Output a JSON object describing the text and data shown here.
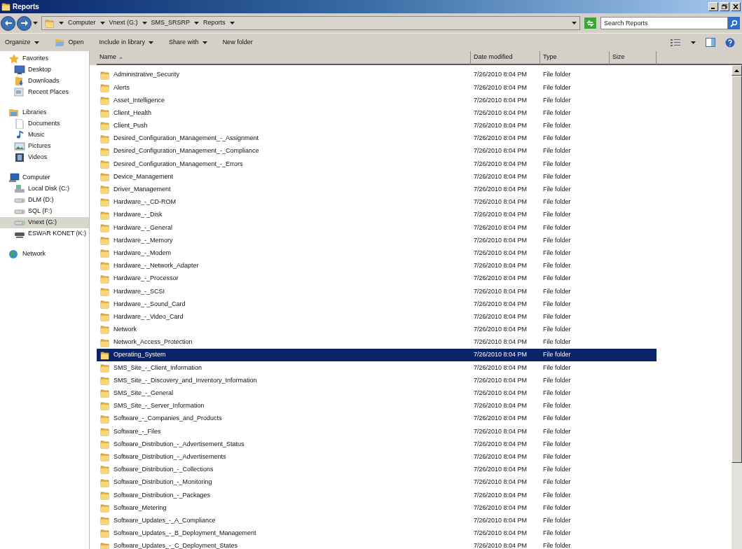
{
  "window": {
    "title": "Reports"
  },
  "address": {
    "crumbs": [
      "Computer",
      "Vnext (G:)",
      "SMS_SRSRP",
      "Reports"
    ]
  },
  "search": {
    "placeholder": "Search Reports"
  },
  "toolbar": [
    {
      "label": "Organize",
      "kind": "menu"
    },
    {
      "label": "Open",
      "kind": "open"
    },
    {
      "label": "Include in library",
      "kind": "menu"
    },
    {
      "label": "Share with",
      "kind": "menu"
    },
    {
      "label": "New folder",
      "kind": "plain"
    }
  ],
  "sidebar": {
    "groups": [
      {
        "label": "Favorites",
        "kind": "star",
        "selected": false,
        "children": [
          {
            "label": "Desktop",
            "kind": "desktop",
            "selected": false
          },
          {
            "label": "Downloads",
            "kind": "downloads",
            "selected": false
          },
          {
            "label": "Recent Places",
            "kind": "recent",
            "selected": false
          }
        ]
      },
      {
        "label": "Libraries",
        "kind": "library",
        "selected": false,
        "children": [
          {
            "label": "Documents",
            "kind": "document",
            "selected": false
          },
          {
            "label": "Music",
            "kind": "music",
            "selected": false
          },
          {
            "label": "Pictures",
            "kind": "pictures",
            "selected": false
          },
          {
            "label": "Videos",
            "kind": "videos",
            "selected": false
          }
        ]
      },
      {
        "label": "Computer",
        "kind": "computer",
        "selected": false,
        "children": [
          {
            "label": "Local Disk (C:)",
            "kind": "system",
            "selected": false
          },
          {
            "label": "DLM (D:)",
            "kind": "disk",
            "selected": false
          },
          {
            "label": "SQL (F:)",
            "kind": "disk",
            "selected": false
          },
          {
            "label": "Vnext (G:)",
            "kind": "disk",
            "selected": true
          },
          {
            "label": "ESWAR KONET (K:)",
            "kind": "netdrive",
            "selected": false
          }
        ]
      },
      {
        "label": "Network",
        "kind": "network",
        "selected": false
      }
    ]
  },
  "table": {
    "columns": [
      {
        "label": "Name",
        "sorted": true
      },
      {
        "label": "Date modified",
        "sorted": false
      },
      {
        "label": "Type",
        "sorted": false
      },
      {
        "label": "Size",
        "sorted": false
      }
    ],
    "rows": [
      {
        "name": "Administrative_Security",
        "date": "7/26/2010 8:04 PM",
        "type": "File folder",
        "selected": false
      },
      {
        "name": "Alerts",
        "date": "7/26/2010 8:04 PM",
        "type": "File folder",
        "selected": false
      },
      {
        "name": "Asset_Intelligence",
        "date": "7/26/2010 8:04 PM",
        "type": "File folder",
        "selected": false
      },
      {
        "name": "Client_Health",
        "date": "7/26/2010 8:04 PM",
        "type": "File folder",
        "selected": false
      },
      {
        "name": "Client_Push",
        "date": "7/26/2010 8:04 PM",
        "type": "File folder",
        "selected": false
      },
      {
        "name": "Desired_Configuration_Management_-_Assignment",
        "date": "7/26/2010 8:04 PM",
        "type": "File folder",
        "selected": false
      },
      {
        "name": "Desired_Configuration_Management_-_Compliance",
        "date": "7/26/2010 8:04 PM",
        "type": "File folder",
        "selected": false
      },
      {
        "name": "Desired_Configuration_Management_-_Errors",
        "date": "7/26/2010 8:04 PM",
        "type": "File folder",
        "selected": false
      },
      {
        "name": "Device_Management",
        "date": "7/26/2010 8:04 PM",
        "type": "File folder",
        "selected": false
      },
      {
        "name": "Driver_Management",
        "date": "7/26/2010 8:04 PM",
        "type": "File folder",
        "selected": false
      },
      {
        "name": "Hardware_-_CD-ROM",
        "date": "7/26/2010 8:04 PM",
        "type": "File folder",
        "selected": false
      },
      {
        "name": "Hardware_-_Disk",
        "date": "7/26/2010 8:04 PM",
        "type": "File folder",
        "selected": false
      },
      {
        "name": "Hardware_-_General",
        "date": "7/26/2010 8:04 PM",
        "type": "File folder",
        "selected": false
      },
      {
        "name": "Hardware_-_Memory",
        "date": "7/26/2010 8:04 PM",
        "type": "File folder",
        "selected": false
      },
      {
        "name": "Hardware_-_Modem",
        "date": "7/26/2010 8:04 PM",
        "type": "File folder",
        "selected": false
      },
      {
        "name": "Hardware_-_Network_Adapter",
        "date": "7/26/2010 8:04 PM",
        "type": "File folder",
        "selected": false
      },
      {
        "name": "Hardware_-_Processor",
        "date": "7/26/2010 8:04 PM",
        "type": "File folder",
        "selected": false
      },
      {
        "name": "Hardware_-_SCSI",
        "date": "7/26/2010 8:04 PM",
        "type": "File folder",
        "selected": false
      },
      {
        "name": "Hardware_-_Sound_Card",
        "date": "7/26/2010 8:04 PM",
        "type": "File folder",
        "selected": false
      },
      {
        "name": "Hardware_-_Video_Card",
        "date": "7/26/2010 8:04 PM",
        "type": "File folder",
        "selected": false
      },
      {
        "name": "Network",
        "date": "7/26/2010 8:04 PM",
        "type": "File folder",
        "selected": false
      },
      {
        "name": "Network_Access_Protection",
        "date": "7/26/2010 8:04 PM",
        "type": "File folder",
        "selected": false
      },
      {
        "name": "Operating_System",
        "date": "7/26/2010 8:04 PM",
        "type": "File folder",
        "selected": true
      },
      {
        "name": "SMS_Site_-_Client_Information",
        "date": "7/26/2010 8:04 PM",
        "type": "File folder",
        "selected": false
      },
      {
        "name": "SMS_Site_-_Discovery_and_Inventory_Information",
        "date": "7/26/2010 8:04 PM",
        "type": "File folder",
        "selected": false
      },
      {
        "name": "SMS_Site_-_General",
        "date": "7/26/2010 8:04 PM",
        "type": "File folder",
        "selected": false
      },
      {
        "name": "SMS_Site_-_Server_Information",
        "date": "7/26/2010 8:04 PM",
        "type": "File folder",
        "selected": false
      },
      {
        "name": "Software_-_Companies_and_Products",
        "date": "7/26/2010 8:04 PM",
        "type": "File folder",
        "selected": false
      },
      {
        "name": "Software_-_Files",
        "date": "7/26/2010 8:04 PM",
        "type": "File folder",
        "selected": false
      },
      {
        "name": "Software_Distribution_-_Advertisement_Status",
        "date": "7/26/2010 8:04 PM",
        "type": "File folder",
        "selected": false
      },
      {
        "name": "Software_Distribution_-_Advertisements",
        "date": "7/26/2010 8:04 PM",
        "type": "File folder",
        "selected": false
      },
      {
        "name": "Software_Distribution_-_Collections",
        "date": "7/26/2010 8:04 PM",
        "type": "File folder",
        "selected": false
      },
      {
        "name": "Software_Distribution_-_Monitoring",
        "date": "7/26/2010 8:04 PM",
        "type": "File folder",
        "selected": false
      },
      {
        "name": "Software_Distribution_-_Packages",
        "date": "7/26/2010 8:04 PM",
        "type": "File folder",
        "selected": false
      },
      {
        "name": "Software_Metering",
        "date": "7/26/2010 8:04 PM",
        "type": "File folder",
        "selected": false
      },
      {
        "name": "Software_Updates_-_A_Compliance",
        "date": "7/26/2010 8:04 PM",
        "type": "File folder",
        "selected": false
      },
      {
        "name": "Software_Updates_-_B_Deployment_Management",
        "date": "7/26/2010 8:04 PM",
        "type": "File folder",
        "selected": false
      },
      {
        "name": "Software_Updates_-_C_Deployment_States",
        "date": "7/26/2010 8:04 PM",
        "type": "File folder",
        "selected": false
      }
    ]
  }
}
